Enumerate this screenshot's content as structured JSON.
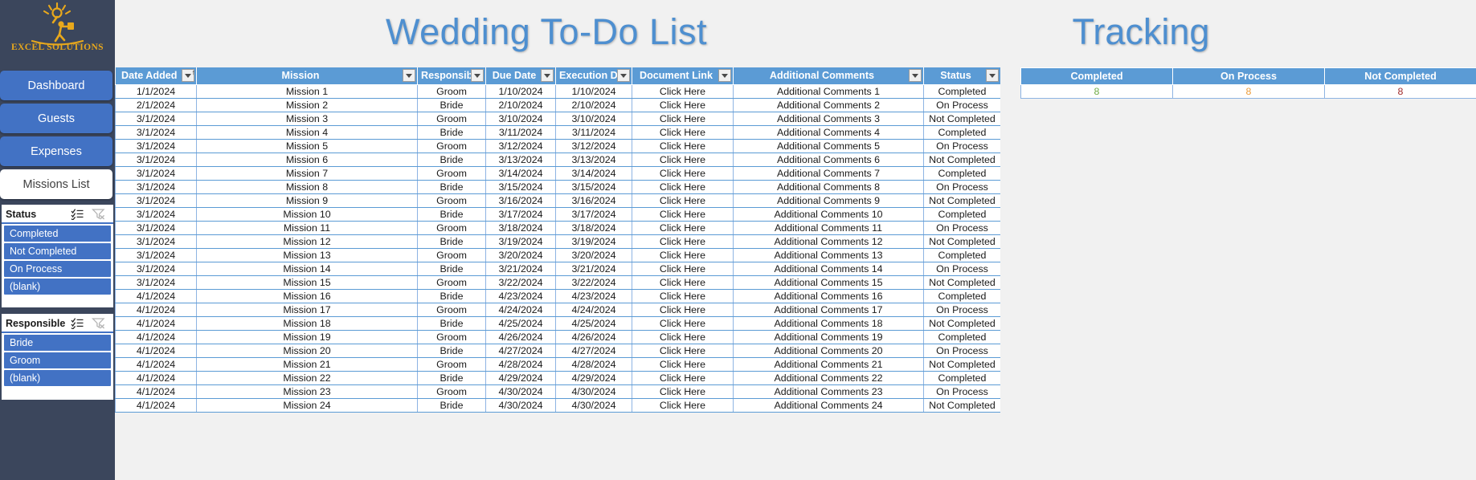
{
  "app": {
    "logo_text": "EXCEL SOLUTIONS",
    "logo_icon": "excel-solutions-mascot-icon"
  },
  "titles": {
    "main": "Wedding To-Do List",
    "tracking": "Tracking",
    "title_color": "#4e8fd0"
  },
  "sidebar": {
    "nav": [
      {
        "label": "Dashboard",
        "active": false
      },
      {
        "label": "Guests",
        "active": false
      },
      {
        "label": "Expenses",
        "active": false
      },
      {
        "label": "Missions List",
        "active": true
      }
    ],
    "slicers": [
      {
        "title": "Status",
        "multiselect_icon": "multi-select-icon",
        "clear_filter_icon": "clear-filter-icon",
        "items": [
          "Completed",
          "Not Completed",
          "On Process",
          "(blank)"
        ]
      },
      {
        "title": "Responsible",
        "multiselect_icon": "multi-select-icon",
        "clear_filter_icon": "clear-filter-icon",
        "items": [
          "Bride",
          "Groom",
          "(blank)"
        ]
      }
    ]
  },
  "table": {
    "header_bg": "#5b9bd5",
    "columns": [
      {
        "label": "Date Added",
        "filter_icon": "sort-filter-icon"
      },
      {
        "label": "Mission",
        "filter_icon": "filter-dropdown-icon"
      },
      {
        "label": "Responsible",
        "filter_icon": "filter-dropdown-icon"
      },
      {
        "label": "Due Date",
        "filter_icon": "filter-dropdown-icon"
      },
      {
        "label": "Execution Dat",
        "filter_icon": "filter-dropdown-icon"
      },
      {
        "label": "Document Link",
        "filter_icon": "filter-dropdown-icon"
      },
      {
        "label": "Additional Comments",
        "filter_icon": "filter-dropdown-icon"
      },
      {
        "label": "Status",
        "filter_icon": "filter-dropdown-icon"
      }
    ],
    "rows": [
      [
        "1/1/2024",
        "Mission 1",
        "Groom",
        "1/10/2024",
        "1/10/2024",
        "Click Here",
        "Additional Comments 1",
        "Completed"
      ],
      [
        "2/1/2024",
        "Mission 2",
        "Bride",
        "2/10/2024",
        "2/10/2024",
        "Click Here",
        "Additional Comments 2",
        "On Process"
      ],
      [
        "3/1/2024",
        "Mission 3",
        "Groom",
        "3/10/2024",
        "3/10/2024",
        "Click Here",
        "Additional Comments 3",
        "Not Completed"
      ],
      [
        "3/1/2024",
        "Mission 4",
        "Bride",
        "3/11/2024",
        "3/11/2024",
        "Click Here",
        "Additional Comments 4",
        "Completed"
      ],
      [
        "3/1/2024",
        "Mission 5",
        "Groom",
        "3/12/2024",
        "3/12/2024",
        "Click Here",
        "Additional Comments 5",
        "On Process"
      ],
      [
        "3/1/2024",
        "Mission 6",
        "Bride",
        "3/13/2024",
        "3/13/2024",
        "Click Here",
        "Additional Comments 6",
        "Not Completed"
      ],
      [
        "3/1/2024",
        "Mission 7",
        "Groom",
        "3/14/2024",
        "3/14/2024",
        "Click Here",
        "Additional Comments 7",
        "Completed"
      ],
      [
        "3/1/2024",
        "Mission 8",
        "Bride",
        "3/15/2024",
        "3/15/2024",
        "Click Here",
        "Additional Comments 8",
        "On Process"
      ],
      [
        "3/1/2024",
        "Mission 9",
        "Groom",
        "3/16/2024",
        "3/16/2024",
        "Click Here",
        "Additional Comments 9",
        "Not Completed"
      ],
      [
        "3/1/2024",
        "Mission 10",
        "Bride",
        "3/17/2024",
        "3/17/2024",
        "Click Here",
        "Additional Comments 10",
        "Completed"
      ],
      [
        "3/1/2024",
        "Mission 11",
        "Groom",
        "3/18/2024",
        "3/18/2024",
        "Click Here",
        "Additional Comments 11",
        "On Process"
      ],
      [
        "3/1/2024",
        "Mission 12",
        "Bride",
        "3/19/2024",
        "3/19/2024",
        "Click Here",
        "Additional Comments 12",
        "Not Completed"
      ],
      [
        "3/1/2024",
        "Mission 13",
        "Groom",
        "3/20/2024",
        "3/20/2024",
        "Click Here",
        "Additional Comments 13",
        "Completed"
      ],
      [
        "3/1/2024",
        "Mission 14",
        "Bride",
        "3/21/2024",
        "3/21/2024",
        "Click Here",
        "Additional Comments 14",
        "On Process"
      ],
      [
        "3/1/2024",
        "Mission 15",
        "Groom",
        "3/22/2024",
        "3/22/2024",
        "Click Here",
        "Additional Comments 15",
        "Not Completed"
      ],
      [
        "4/1/2024",
        "Mission 16",
        "Bride",
        "4/23/2024",
        "4/23/2024",
        "Click Here",
        "Additional Comments 16",
        "Completed"
      ],
      [
        "4/1/2024",
        "Mission 17",
        "Groom",
        "4/24/2024",
        "4/24/2024",
        "Click Here",
        "Additional Comments 17",
        "On Process"
      ],
      [
        "4/1/2024",
        "Mission 18",
        "Bride",
        "4/25/2024",
        "4/25/2024",
        "Click Here",
        "Additional Comments 18",
        "Not Completed"
      ],
      [
        "4/1/2024",
        "Mission 19",
        "Groom",
        "4/26/2024",
        "4/26/2024",
        "Click Here",
        "Additional Comments 19",
        "Completed"
      ],
      [
        "4/1/2024",
        "Mission 20",
        "Bride",
        "4/27/2024",
        "4/27/2024",
        "Click Here",
        "Additional Comments 20",
        "On Process"
      ],
      [
        "4/1/2024",
        "Mission 21",
        "Groom",
        "4/28/2024",
        "4/28/2024",
        "Click Here",
        "Additional Comments 21",
        "Not Completed"
      ],
      [
        "4/1/2024",
        "Mission 22",
        "Bride",
        "4/29/2024",
        "4/29/2024",
        "Click Here",
        "Additional Comments 22",
        "Completed"
      ],
      [
        "4/1/2024",
        "Mission 23",
        "Groom",
        "4/30/2024",
        "4/30/2024",
        "Click Here",
        "Additional Comments 23",
        "On Process"
      ],
      [
        "4/1/2024",
        "Mission 24",
        "Bride",
        "4/30/2024",
        "4/30/2024",
        "Click Here",
        "Additional Comments 24",
        "Not Completed"
      ]
    ]
  },
  "tracking": {
    "columns": [
      "Completed",
      "On Process",
      "Not Completed"
    ],
    "values": [
      "8",
      "8",
      "8"
    ]
  },
  "status_colors": {
    "Completed": "#70ad47",
    "On Process": "#ed9c3a",
    "Not Completed": "#a02b2b"
  }
}
